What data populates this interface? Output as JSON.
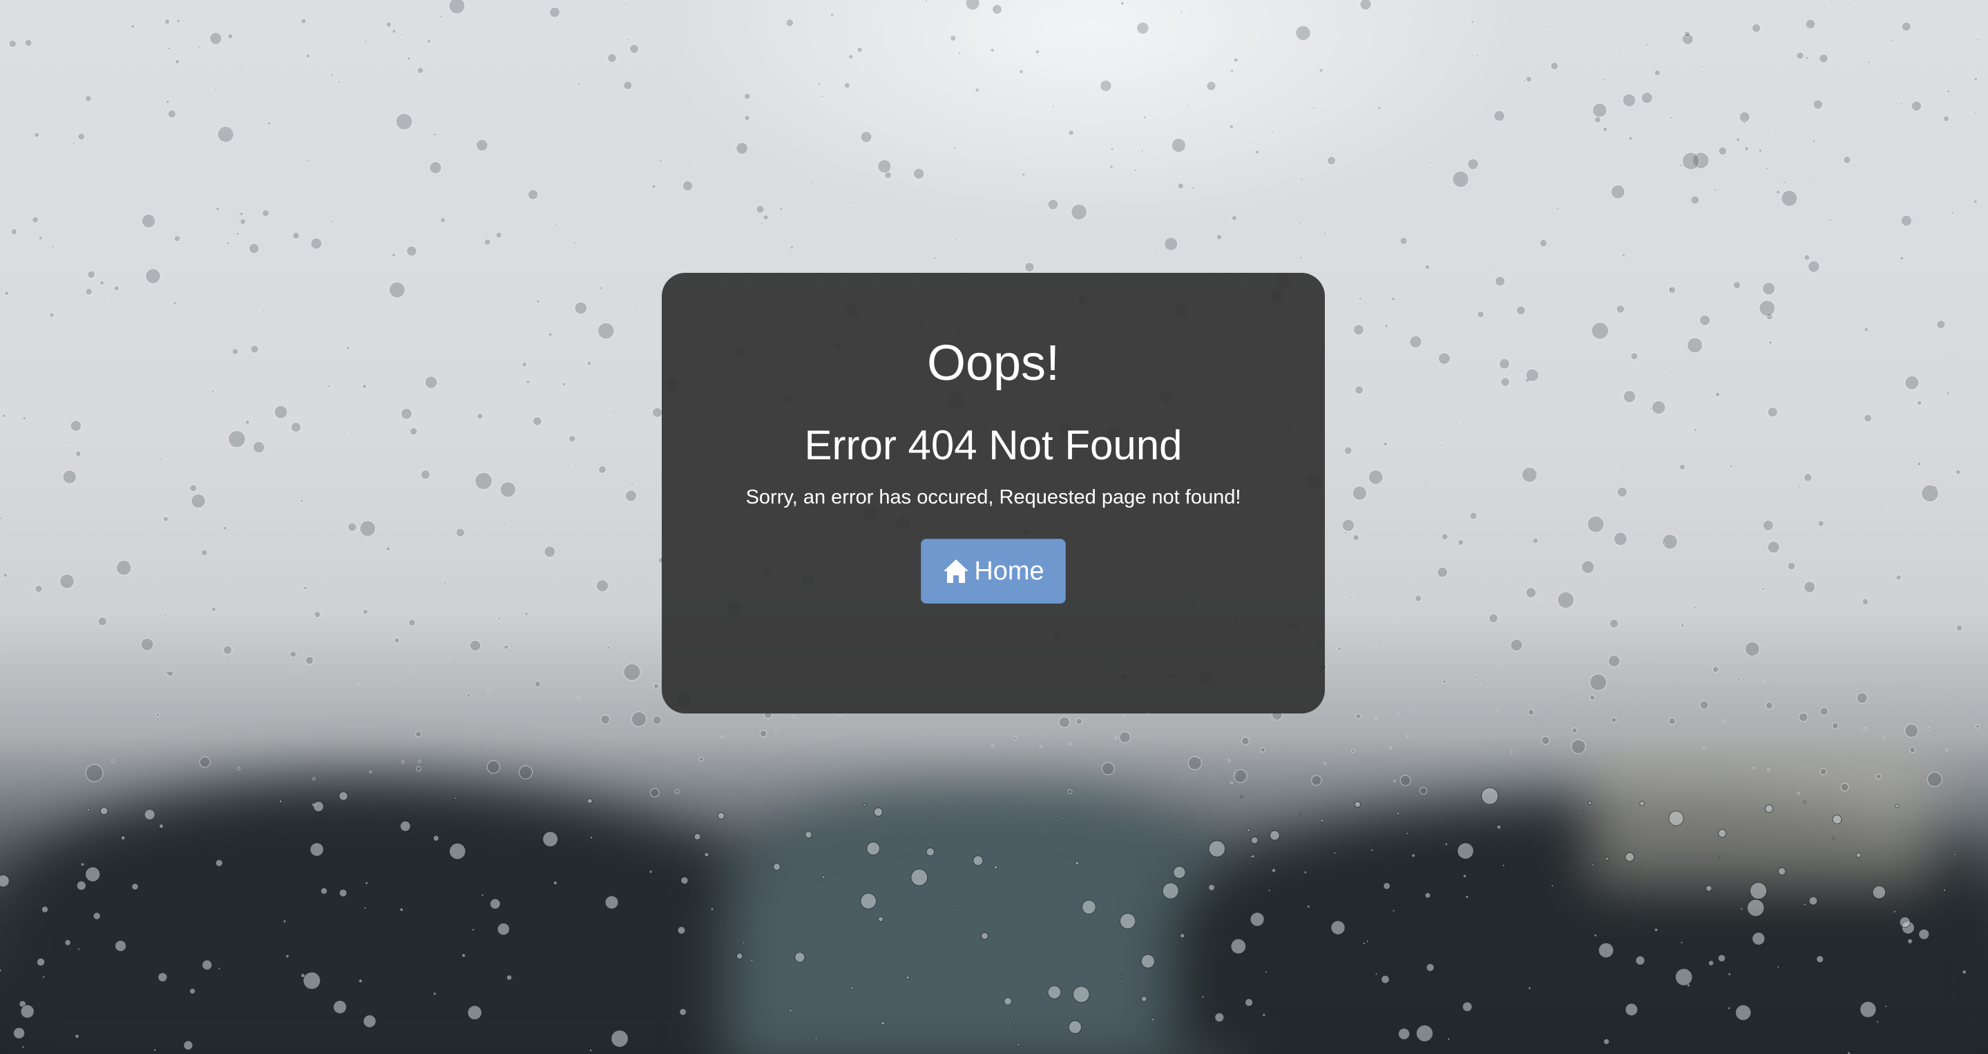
{
  "error_card": {
    "heading": "Oops!",
    "title": "Error 404 Not Found",
    "message": "Sorry, an error has occured, Requested page not found!",
    "home_button": {
      "label": "Home",
      "icon": "home-icon"
    }
  },
  "colors": {
    "card_background": "#323232",
    "button_background": "#6f98cf",
    "text": "#ffffff"
  },
  "background": {
    "icon": "rain-on-window-photo"
  }
}
